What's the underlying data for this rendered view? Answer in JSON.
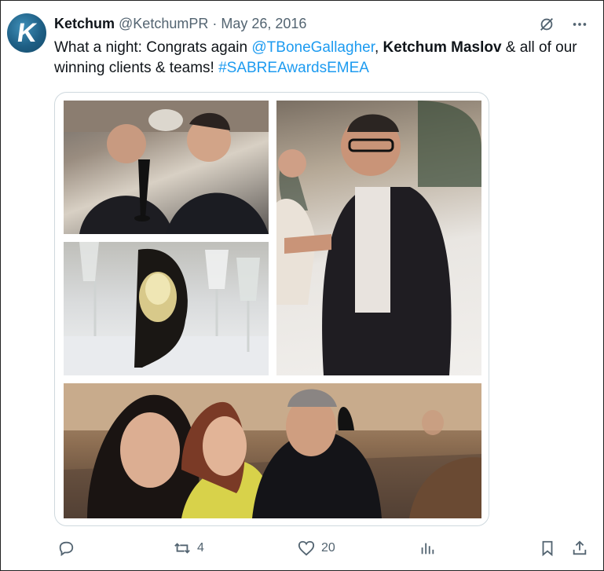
{
  "tweet": {
    "author_name": "Ketchum",
    "author_handle": "@KetchumPR",
    "separator": " · ",
    "date": "May 26, 2016",
    "avatar_letter": "K",
    "text_parts": {
      "t1": "What a night: Congrats again ",
      "mention1": "@TBoneGallagher",
      "t2": ", ",
      "bold1": "Ketchum Maslov",
      "t3": " & all of our winning clients & teams! ",
      "hashtag": "#SABREAwardsEMEA"
    }
  },
  "media": {
    "photos": [
      "award-photo-two-men",
      "award-photo-man-pointing",
      "award-photo-trophy-glasses",
      "award-photo-group-selfie"
    ]
  },
  "actions": {
    "reply_count": "",
    "retweet_count": "4",
    "like_count": "20",
    "views_count": ""
  },
  "colors": {
    "link": "#1d9bf0",
    "muted": "#536471",
    "text": "#0f1419",
    "avatar": "#1e5f85"
  },
  "icons": [
    "grok-icon",
    "more-icon",
    "reply-icon",
    "retweet-icon",
    "like-icon",
    "views-icon",
    "bookmark-icon",
    "share-icon"
  ]
}
